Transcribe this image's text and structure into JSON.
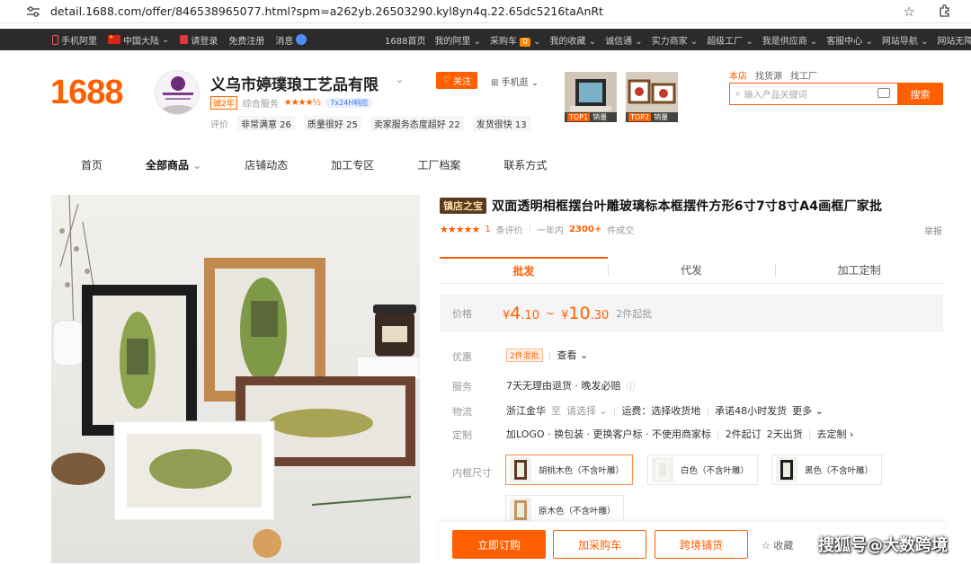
{
  "browser": {
    "url": "detail.1688.com/offer/846538965077.html?spm=a262yb.26503290.kyl8yn4q.22.65dc5216taAnRt"
  },
  "topbar": {
    "mobile": "手机阿里",
    "region": "中国大陆",
    "login": "请登录",
    "register": "免费注册",
    "messages": "消息",
    "links": [
      "1688首页",
      "我的阿里",
      "采购车",
      "我的收藏",
      "诚信通",
      "实力商家",
      "超级工厂",
      "我是供应商",
      "客服中心",
      "网站导航",
      "网站无障碍"
    ],
    "cart_count": "0"
  },
  "header": {
    "logo": "1688",
    "shop_name": "义乌市婷璞琅工艺品有限",
    "avatar_text": "义乌市婷璞琅工艺品有限公司",
    "years": "诚2年",
    "service_label": "综合服务",
    "service_stars": "★★★★½",
    "svc247": "7x24H响应",
    "eval_label": "评价",
    "scores": [
      "非常满意 26",
      "质量很好 25",
      "卖家服务态度超好 22",
      "发货很快 13"
    ],
    "follow": "关注",
    "mobile_view": "手机逛",
    "top_products": [
      {
        "rank": "TOP1",
        "label": "销量"
      },
      {
        "rank": "TOP2",
        "label": "销量"
      }
    ],
    "search_tabs": [
      "本店",
      "找货源",
      "找工厂"
    ],
    "search_placeholder": "输入产品关键词",
    "search_button": "搜索"
  },
  "nav": {
    "items": [
      "首页",
      "全部商品",
      "店铺动态",
      "加工专区",
      "工厂档案",
      "联系方式"
    ]
  },
  "product": {
    "badge": "镇店之宝",
    "title": "双面透明相框摆台叶雕玻璃标本框摆件方形6寸7寸8寸A4画框厂家批",
    "stars": "★★★★★",
    "reviews_count": "1",
    "reviews_label": "条评价",
    "year_label": "一年内",
    "sold": "2300+",
    "sold_label": "件成交",
    "report": "举报",
    "tabs": [
      "批发",
      "代发",
      "加工定制"
    ],
    "price_label": "价格",
    "price_low": {
      "symbol": "¥",
      "int": "4",
      "dec": ".10"
    },
    "price_high": {
      "symbol": "¥",
      "int": "10",
      "dec": ".30"
    },
    "tilde": "~",
    "moq": "2件起批",
    "promo_label": "优惠",
    "promo_tag": "2件混批",
    "promo_more": "查看",
    "service_label": "服务",
    "service_value": "7天无理由退货 · 晚发必赔",
    "logistics_label": "物流",
    "logistics_from": "浙江金华",
    "logistics_to": "至",
    "logistics_choose": "请选择",
    "logistics_shipping": "运费：选择收货地",
    "logistics_promise": "承诺48小时发货",
    "logistics_more": "更多",
    "custom_label": "定制",
    "custom_value": "加LOGO · 换包装 · 更换客户标 · 不使用商家标",
    "custom_moq": "2件起订",
    "custom_days": "2天出货",
    "custom_link": "去定制",
    "size_label": "内框尺寸",
    "skus": [
      "胡桃木色（不含叶雕）",
      "白色（不含叶雕）",
      "黑色（不含叶雕）",
      "原木色（不含叶雕）"
    ]
  },
  "actions": {
    "order": "立即订购",
    "cart": "加采购车",
    "distribute": "跨境铺货",
    "favorite": "收藏"
  },
  "watermark": "搜狐号@大数跨境",
  "colors": {
    "accent": "#ff5f00",
    "topbar": "#2b2b2b"
  }
}
